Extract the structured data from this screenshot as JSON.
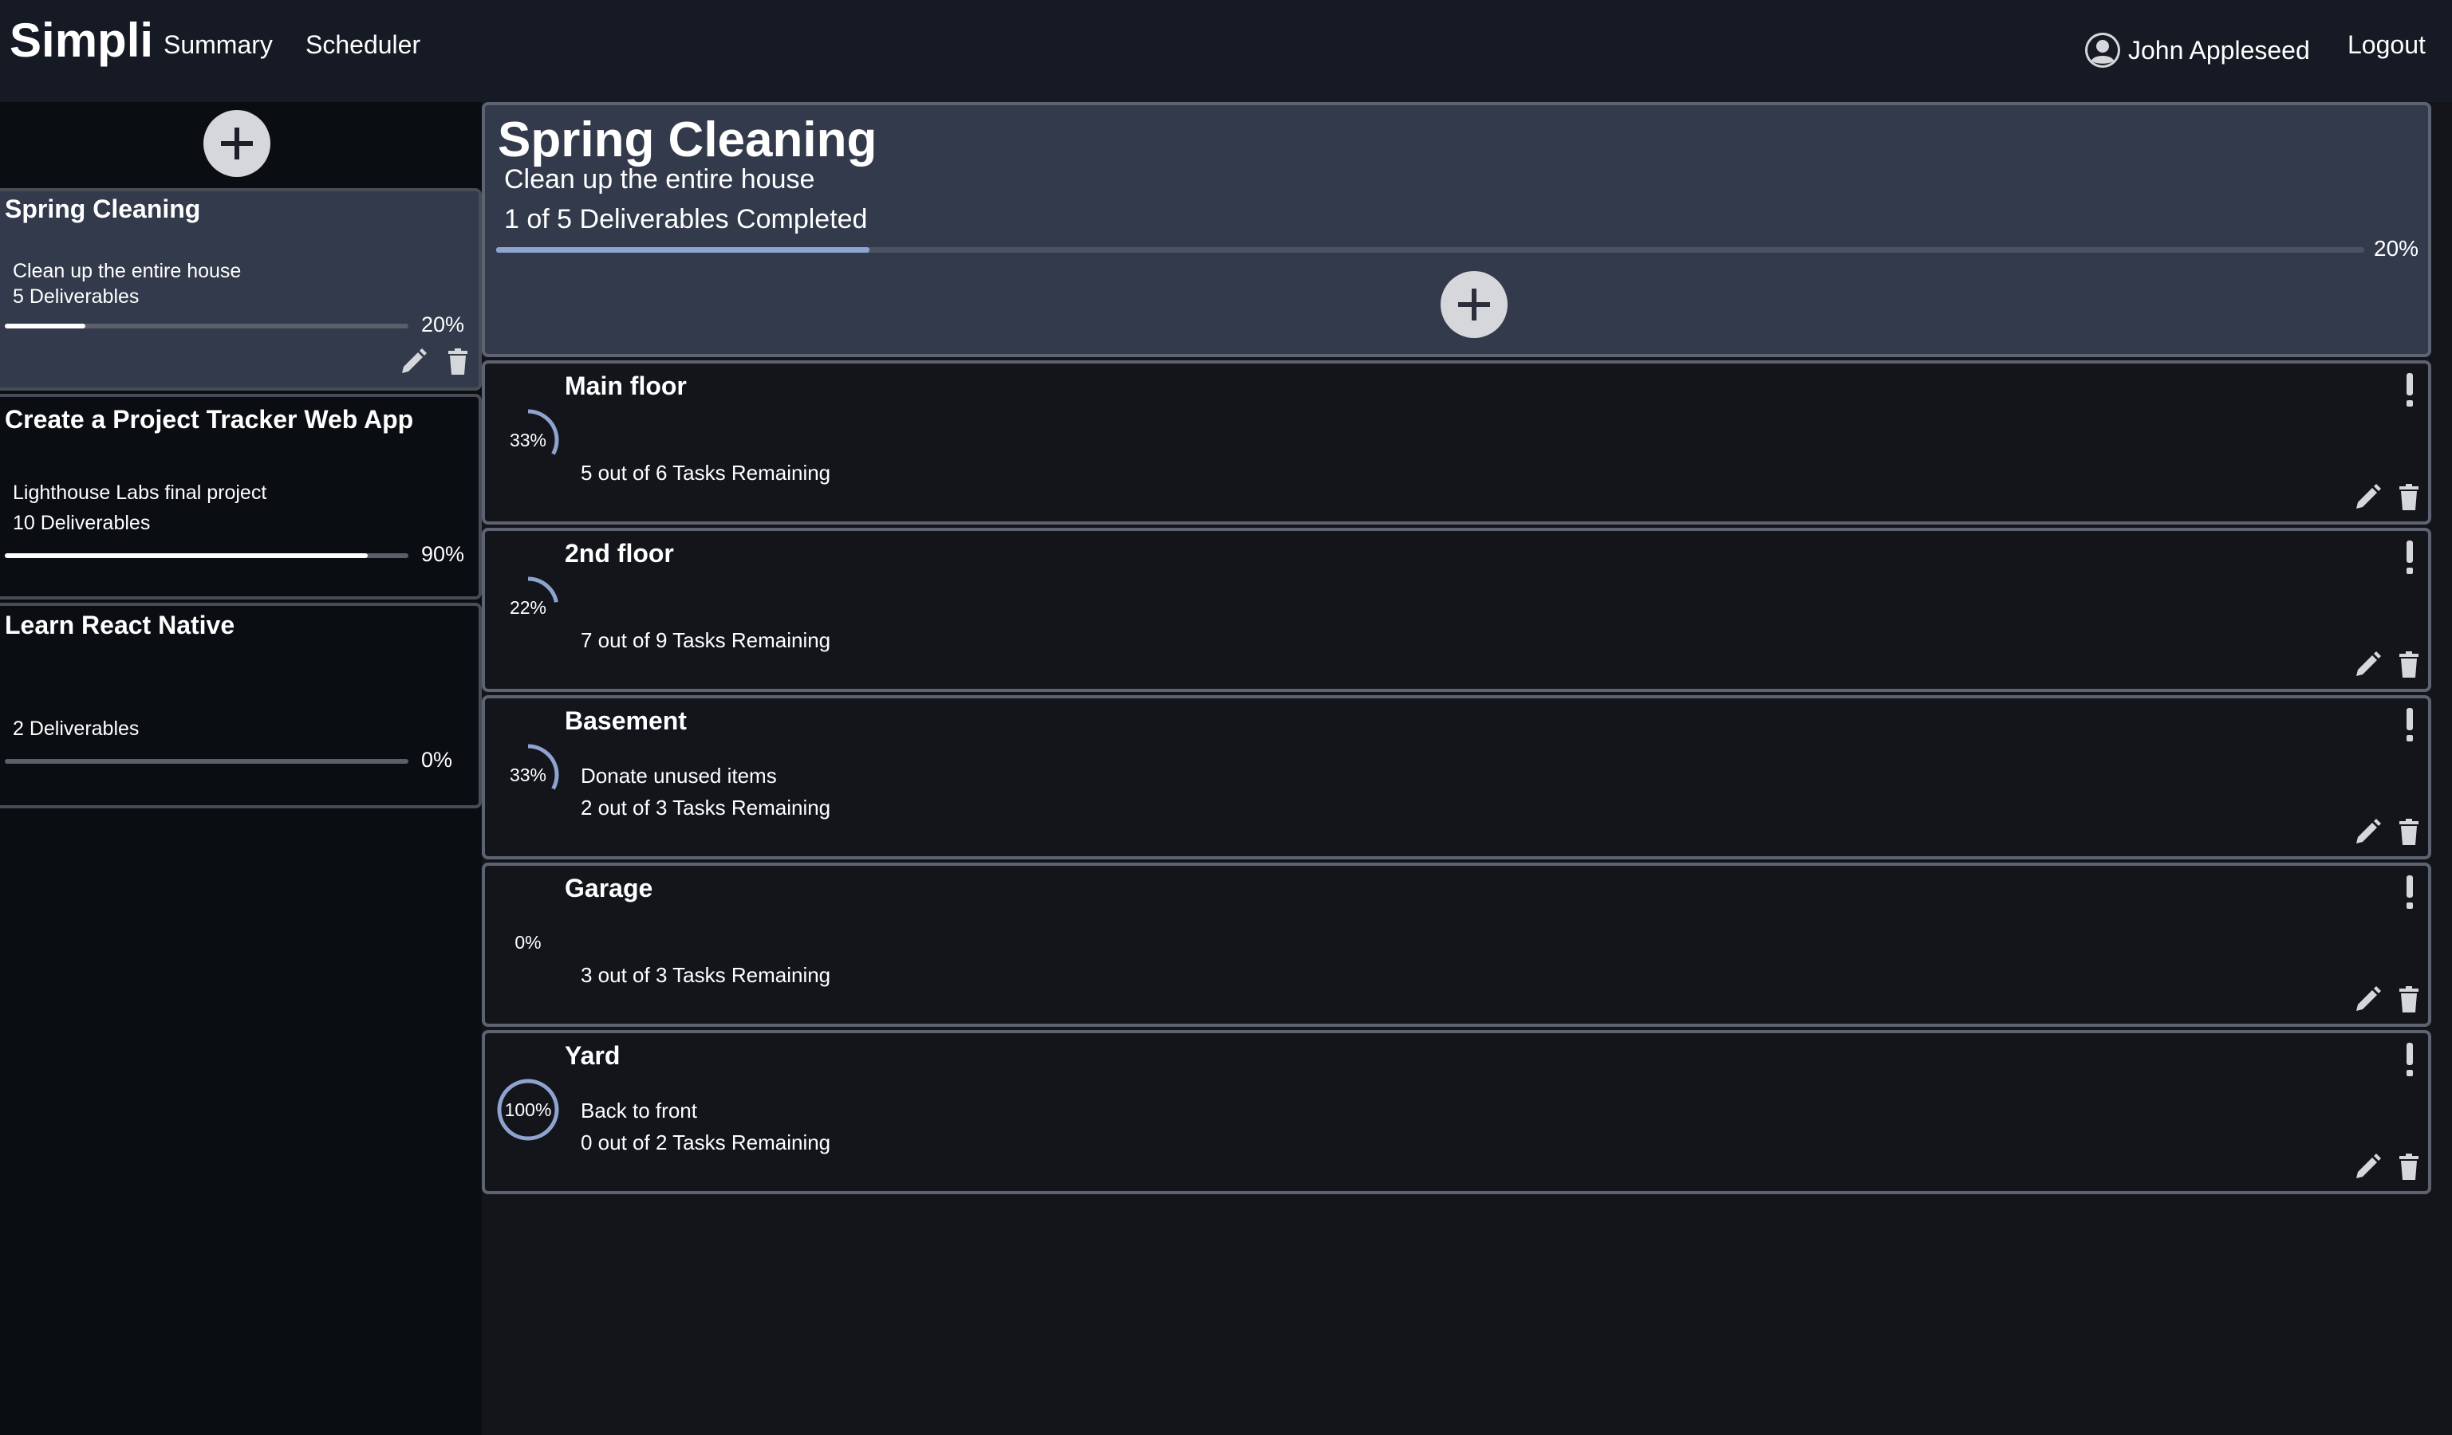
{
  "nav": {
    "brand": "Simpli",
    "links": [
      "Summary",
      "Scheduler"
    ],
    "user_name": "John Appleseed",
    "logout": "Logout",
    "user_icon": "user-circle-icon"
  },
  "sidebar": {
    "add_icon": "plus-icon",
    "projects": [
      {
        "title": "Spring Cleaning",
        "description": "Clean up the entire house",
        "deliverables": "5 Deliverables",
        "progress_pct": 20,
        "progress_label": "20%",
        "active": true
      },
      {
        "title": "Create a Project Tracker Web App",
        "description": "Lighthouse Labs final project",
        "deliverables": "10 Deliverables",
        "progress_pct": 90,
        "progress_label": "90%",
        "active": false
      },
      {
        "title": "Learn React Native",
        "description": "",
        "deliverables": "2 Deliverables",
        "progress_pct": 0,
        "progress_label": "0%",
        "active": false
      }
    ]
  },
  "project": {
    "title": "Spring Cleaning",
    "description": "Clean up the entire house",
    "completed": "1 of 5 Deliverables Completed",
    "progress_pct": 20,
    "progress_label": "20%"
  },
  "deliverables": [
    {
      "title": "Main floor",
      "percent": 33,
      "percent_label": "33%",
      "description": "",
      "tasks": "5 out of 6 Tasks Remaining"
    },
    {
      "title": "2nd floor",
      "percent": 22,
      "percent_label": "22%",
      "description": "",
      "tasks": "7 out of 9 Tasks Remaining"
    },
    {
      "title": "Basement",
      "percent": 33,
      "percent_label": "33%",
      "description": "Donate unused items",
      "tasks": "2 out of 3 Tasks Remaining"
    },
    {
      "title": "Garage",
      "percent": 0,
      "percent_label": "0%",
      "description": "",
      "tasks": "3 out of 3 Tasks Remaining"
    },
    {
      "title": "Yard",
      "percent": 100,
      "percent_label": "100%",
      "description": "Back to front",
      "tasks": "0 out of 2 Tasks Remaining"
    }
  ],
  "colors": {
    "accent": "#8fa3cf",
    "card_active": "#323a4b",
    "border": "#5d6370"
  }
}
